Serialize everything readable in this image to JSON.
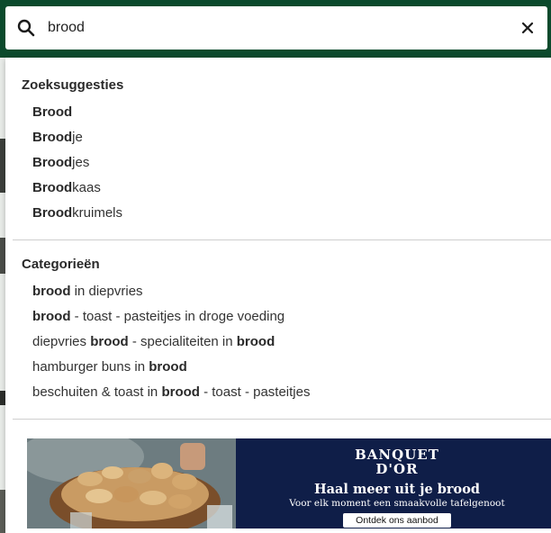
{
  "search": {
    "value": "brood",
    "icon": "search-icon",
    "clear_icon": "close-icon"
  },
  "suggestions": {
    "title": "Zoeksuggesties",
    "items": [
      {
        "bold": "Brood",
        "rest": ""
      },
      {
        "bold": "Brood",
        "rest": "je"
      },
      {
        "bold": "Brood",
        "rest": "jes"
      },
      {
        "bold": "Brood",
        "rest": "kaas"
      },
      {
        "bold": "Brood",
        "rest": "kruimels"
      }
    ]
  },
  "categories": {
    "title": "Categorieën",
    "items": [
      [
        {
          "t": "brood",
          "b": true
        },
        {
          "t": " in diepvries",
          "b": false
        }
      ],
      [
        {
          "t": "brood",
          "b": true
        },
        {
          "t": " - toast - pasteitjes in droge voeding",
          "b": false
        }
      ],
      [
        {
          "t": "diepvries ",
          "b": false
        },
        {
          "t": "brood",
          "b": true
        },
        {
          "t": " - specialiteiten in ",
          "b": false
        },
        {
          "t": "brood",
          "b": true
        }
      ],
      [
        {
          "t": "hamburger buns in ",
          "b": false
        },
        {
          "t": "brood",
          "b": true
        }
      ],
      [
        {
          "t": "beschuiten & toast in ",
          "b": false
        },
        {
          "t": "brood",
          "b": true
        },
        {
          "t": " - toast - pasteitjes",
          "b": false
        }
      ]
    ]
  },
  "promo": {
    "brand_line1": "BANQUET",
    "brand_line2": "D'OR",
    "headline": "Haal meer uit je brood",
    "subline": "Voor elk moment een smaakvolle tafelgenoot",
    "cta": "Ontdek ons aanbod"
  },
  "colors": {
    "header_green": "#0b4a2c",
    "promo_navy": "#0f1e48"
  }
}
